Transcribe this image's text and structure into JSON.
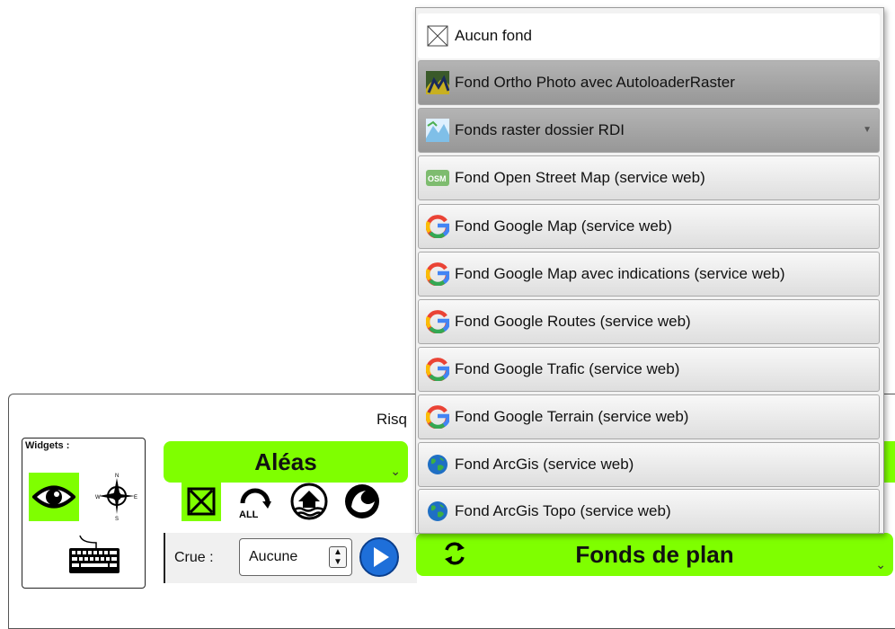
{
  "panel": {
    "title_partial": "Risq"
  },
  "widgets": {
    "label": "Widgets :"
  },
  "aleas_button": {
    "label": "Aléas"
  },
  "fonds_button": {
    "label": "Fonds de plan"
  },
  "crue": {
    "label": "Crue :",
    "value": "Aucune"
  },
  "icons": {
    "all_label": "ALL"
  },
  "basemap_menu": {
    "items": [
      {
        "label": "Aucun fond",
        "icon": "empty-box-icon"
      },
      {
        "label": "Fond Ortho Photo avec AutoloaderRaster",
        "icon": "ortho-photo-icon"
      },
      {
        "label": "Fonds raster dossier RDI",
        "icon": "raster-map-icon"
      },
      {
        "label": "Fond Open Street Map (service web)",
        "icon": "osm-icon",
        "icon_text": "OSM"
      },
      {
        "label": "Fond Google Map (service web)",
        "icon": "google-icon"
      },
      {
        "label": "Fond Google Map avec indications (service web)",
        "icon": "google-icon"
      },
      {
        "label": "Fond Google Routes (service web)",
        "icon": "google-icon"
      },
      {
        "label": "Fond Google Trafic (service web)",
        "icon": "google-icon"
      },
      {
        "label": "Fond Google Terrain (service web)",
        "icon": "google-icon"
      },
      {
        "label": "Fond ArcGis (service web)",
        "icon": "globe-icon"
      },
      {
        "label": "Fond ArcGis Topo (service web)",
        "icon": "globe-icon"
      }
    ]
  },
  "colors": {
    "accent_green": "#7fff00",
    "google_blue": "#4285f4",
    "google_red": "#ea4335",
    "google_yellow": "#fbbc05",
    "google_green": "#34a853"
  }
}
